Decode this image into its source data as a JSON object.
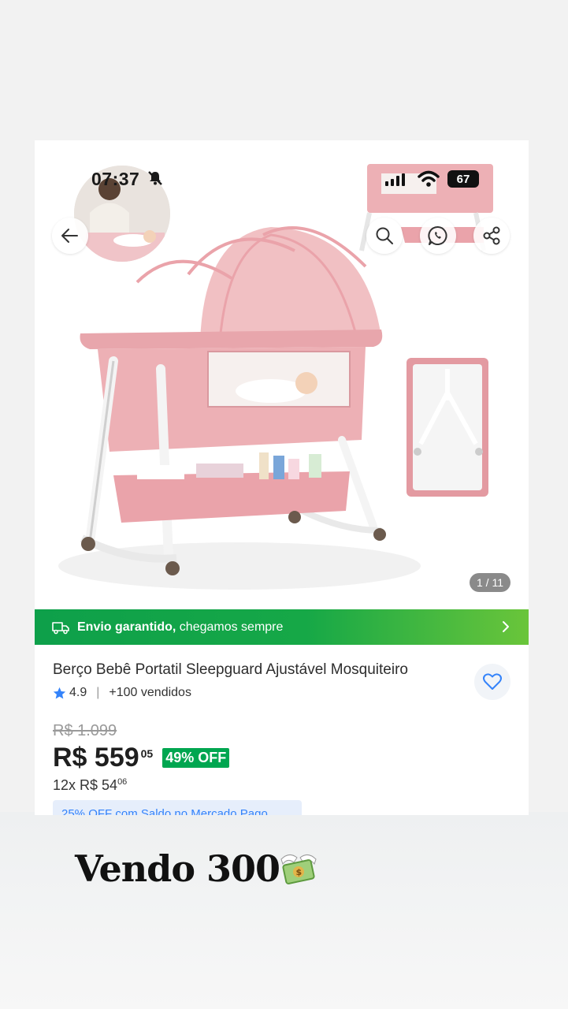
{
  "status_bar": {
    "time": "07:37",
    "battery": "67"
  },
  "gallery": {
    "counter": "1 / 11"
  },
  "shipping": {
    "bold_text": "Envio garantido,",
    "rest_text": " chegamos sempre"
  },
  "product": {
    "title": "Berço Bebê Portatil Sleepguard Ajustável Mosquiteiro",
    "rating": "4.9",
    "sold": "+100 vendidos",
    "old_price": "R$ 1.099",
    "price": "R$ 559",
    "price_cents": "05",
    "discount": "49% OFF",
    "installments_prefix": "12x R$ 54",
    "installments_cents": "06",
    "promo": "25% OFF com Saldo no Mercado Pago"
  },
  "caption": {
    "text": "Vendo 300"
  },
  "colors": {
    "shipping_green": "#16a847",
    "discount_green": "#00a650",
    "link_blue": "#3483fa",
    "crib_pink": "#e9a7ad"
  }
}
